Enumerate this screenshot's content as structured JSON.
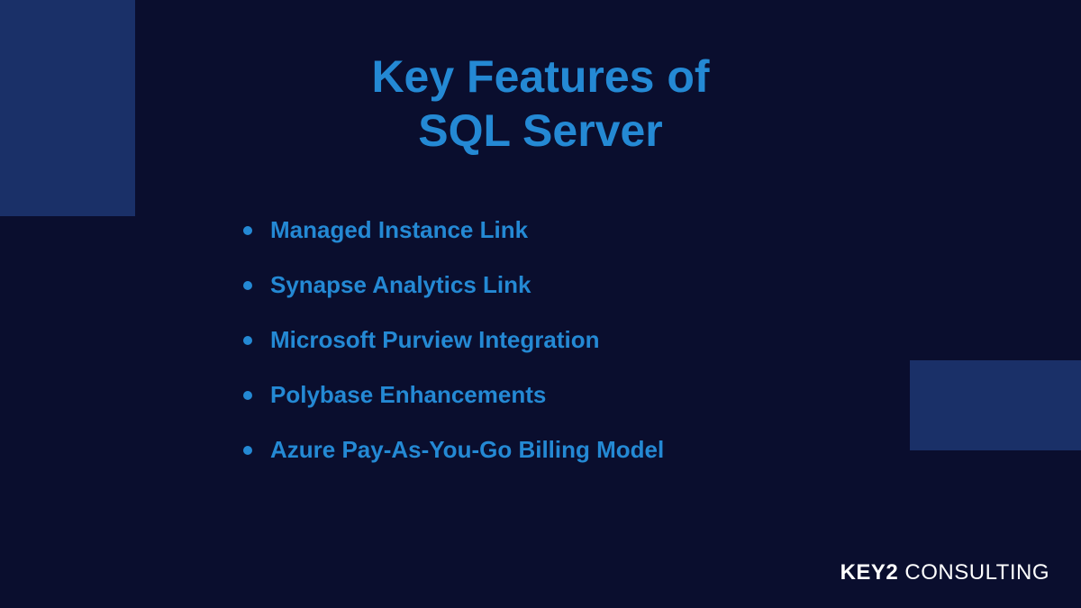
{
  "title": {
    "line1": "Key Features of",
    "line2": "SQL Server"
  },
  "features": [
    "Managed Instance Link",
    "Synapse Analytics Link",
    "Microsoft Purview Integration",
    "Polybase Enhancements",
    "Azure Pay-As-You-Go Billing Model"
  ],
  "footer": {
    "brand_bold": "KEY2",
    "brand_light": " CONSULTING"
  }
}
